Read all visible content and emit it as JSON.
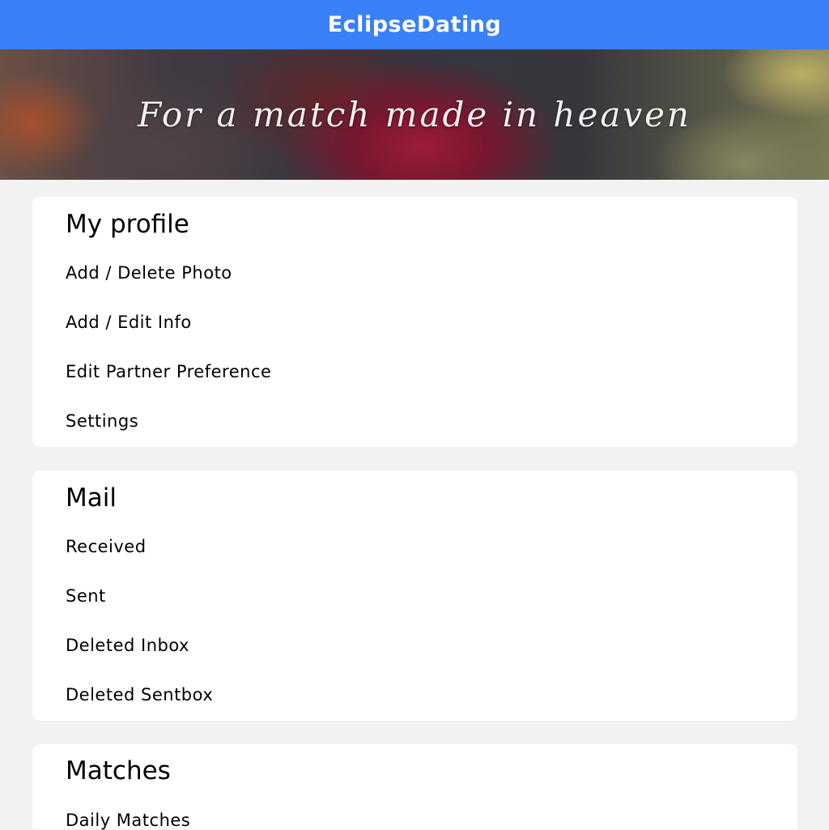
{
  "app": {
    "title": "EclipseDating"
  },
  "banner": {
    "tagline": "For a match made in heaven"
  },
  "sections": [
    {
      "title": "My profile",
      "items": [
        "Add / Delete Photo",
        "Add / Edit Info",
        "Edit Partner Preference",
        "Settings"
      ]
    },
    {
      "title": "Mail",
      "items": [
        "Received",
        "Sent",
        "Deleted Inbox",
        "Deleted Sentbox"
      ]
    },
    {
      "title": "Matches",
      "items": [
        "Daily Matches"
      ]
    }
  ],
  "colors": {
    "app_bar": "#3a80f8",
    "background": "#f2f2f2",
    "card": "#ffffff"
  }
}
